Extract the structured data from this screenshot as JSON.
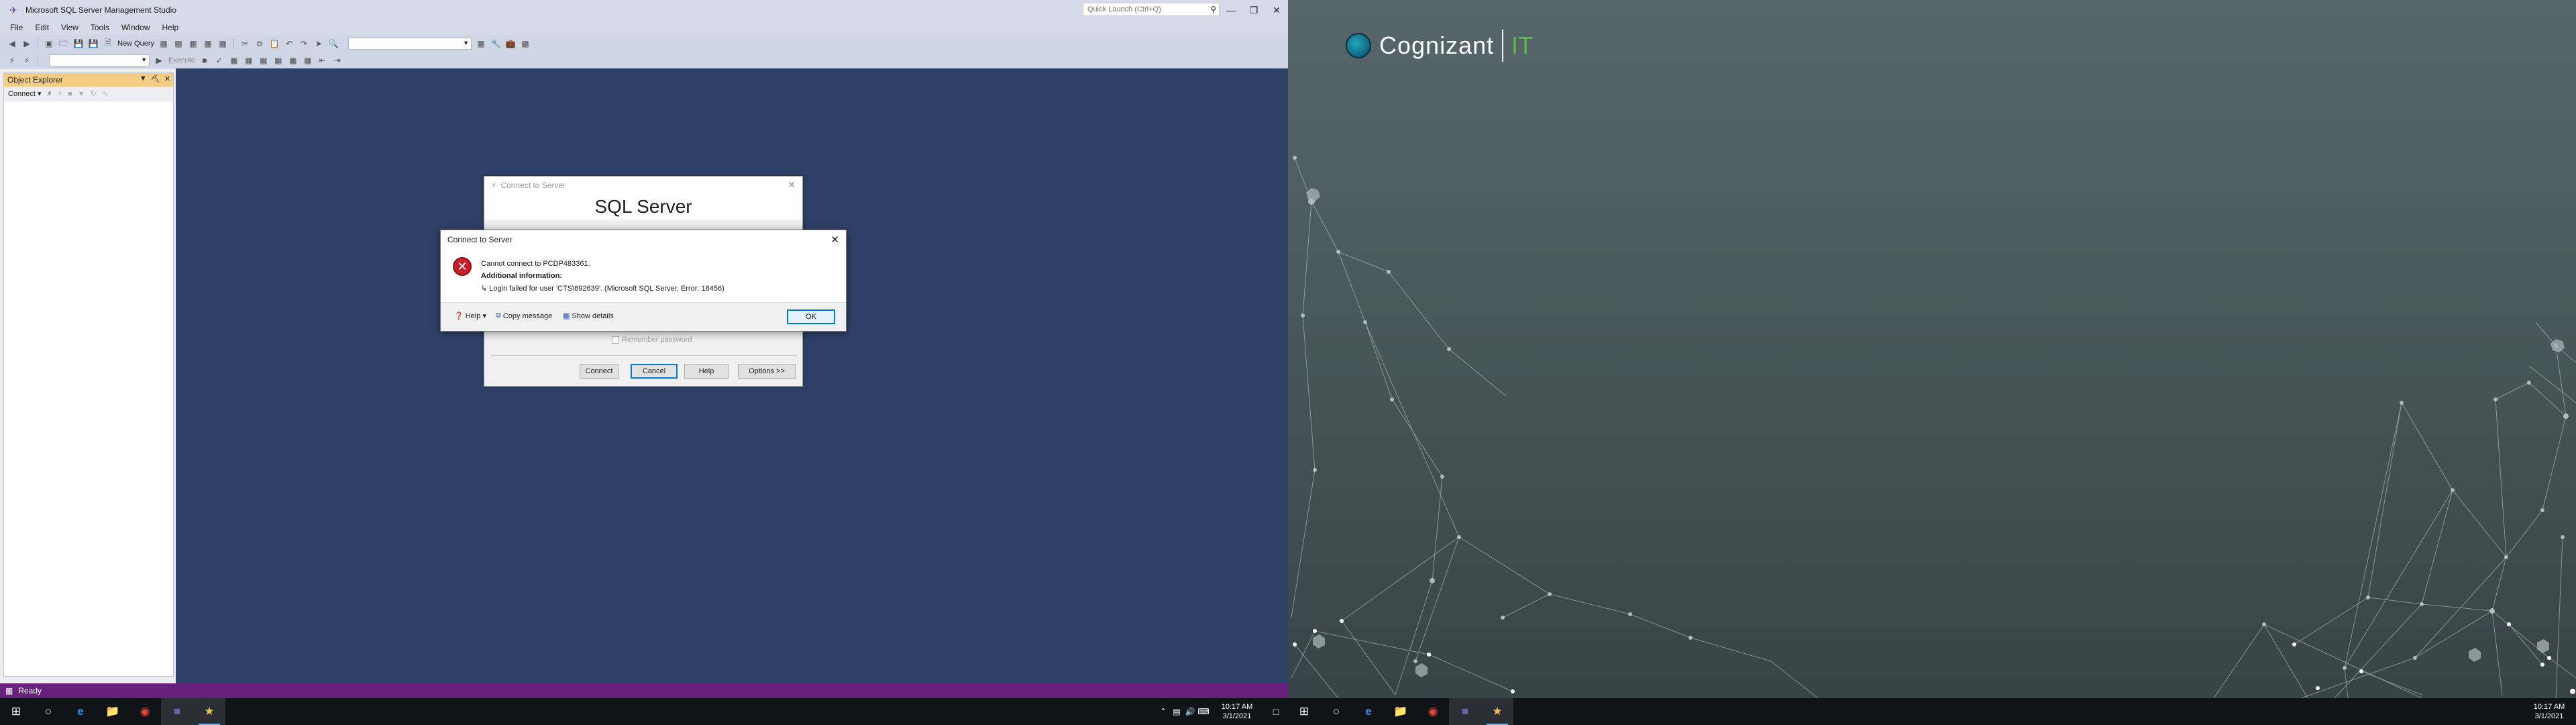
{
  "ssms": {
    "title": "Microsoft SQL Server Management Studio",
    "quick_launch_placeholder": "Quick Launch (Ctrl+Q)",
    "menu": [
      "File",
      "Edit",
      "View",
      "Tools",
      "Window",
      "Help"
    ],
    "toolbar": {
      "new_query": "New Query",
      "execute": "Execute"
    },
    "object_explorer": {
      "title": "Object Explorer",
      "connect": "Connect"
    },
    "status": "Ready"
  },
  "connect_dialog": {
    "title": "Connect to Server",
    "banner": "SQL Server",
    "remember_password": "Remember password",
    "buttons": {
      "connect": "Connect",
      "cancel": "Cancel",
      "help": "Help",
      "options": "Options >>"
    }
  },
  "error_dialog": {
    "title": "Connect to Server",
    "message": "Cannot connect to PCDP483361.",
    "additional_heading": "Additional information:",
    "detail": "Login failed for user 'CTS\\892639'. (Microsoft SQL Server, Error: 18456)",
    "help": "Help",
    "copy_message": "Copy message",
    "show_details": "Show details",
    "ok": "OK"
  },
  "taskbar_left": {
    "time": "10:17 AM",
    "date": "3/1/2021"
  },
  "taskbar_right": {
    "time": "10:17 AM",
    "date": "3/1/2021"
  },
  "wallpaper": {
    "brand": "Cognizant",
    "brand_suffix": "IT",
    "colors": {
      "brand_suffix": "#5bbb46",
      "background": "#4a595d"
    }
  }
}
